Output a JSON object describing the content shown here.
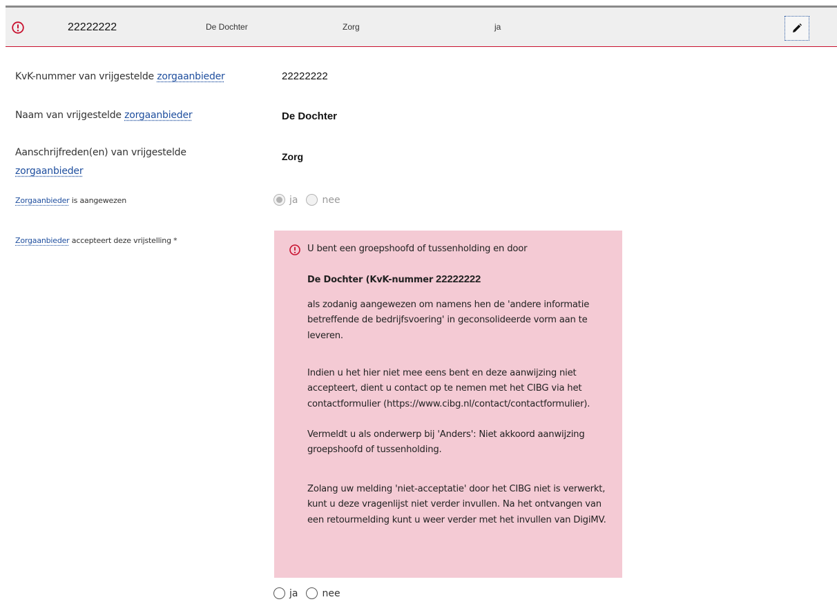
{
  "header_row": {
    "kvk_nummer": "22222222",
    "naam": "De Dochter",
    "aanschrijfnaam": "Zorg",
    "aangewezen": "ja",
    "alert_icon": "exclamation-circle-icon",
    "edit_icon": "pencil-icon"
  },
  "colors": {
    "accent_red": "#c8102e",
    "warning_bg": "#f4cad4",
    "link_blue": "#1e4e9e"
  },
  "fields": {
    "kvk": {
      "label_pre": "KvK-nummer van vrijgestelde ",
      "label_term": "zorgaanbieder",
      "value": "22222222"
    },
    "naam": {
      "label_pre": "Naam van vrijgestelde ",
      "label_term": "zorgaanbieder",
      "value": "De Dochter"
    },
    "aanschrijf": {
      "label_pre": "Aanschrijfreden(en) van vrijgestelde",
      "label_term": "zorgaanbieder",
      "value": "Zorg"
    },
    "aangewezen": {
      "label_term": "Zorgaanbieder",
      "label_post": " is aangewezen",
      "options": [
        "ja",
        "nee"
      ],
      "selected": "ja"
    },
    "accepteert": {
      "label_term": "Zorgaanbieder",
      "label_post": " accepteert deze vrijstelling *",
      "options": [
        "ja",
        "nee"
      ]
    }
  },
  "warning": {
    "line1": "U bent een groepshoofd of tussenholding en door",
    "strong": "De Dochter (KvK-nummer",
    "strong_kvk": "22222222",
    "para1": "als zodanig aangewezen om namens hen de 'andere informatie betreffende de bedrijfsvoering' in geconsolideerde vorm aan te leveren.",
    "para2": "Indien u het hier niet mee eens bent en deze aanwijzing niet accepteert, dient u contact op te nemen met het CIBG via het contactformulier (https://www.cibg.nl/contact/contactformulier).",
    "para3": "Vermeldt u als onderwerp bij 'Anders': Niet akkoord aanwijzing groepshoofd of tussenholding.",
    "para4": "Zolang uw melding 'niet-acceptatie' door het CIBG niet is verwerkt, kunt u deze vragenlijst niet verder invullen. Na het ontvangen van een retourmelding kunt u weer verder met het invullen van DigiMV."
  }
}
